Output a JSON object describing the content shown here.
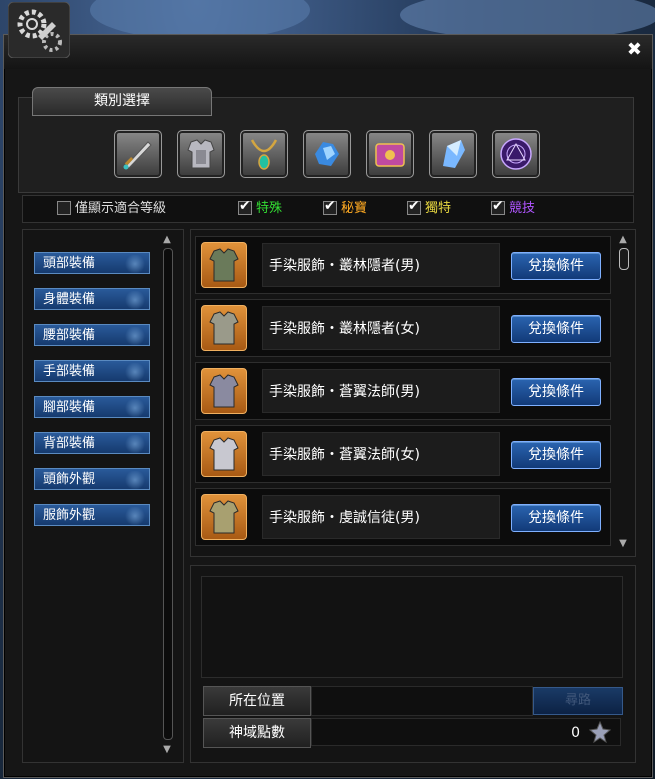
{
  "window": {
    "close_glyph": "✖"
  },
  "category": {
    "tab_label": "類別選擇",
    "icons": [
      "sword-icon",
      "armor-icon",
      "necklace-icon",
      "crystal-cluster-icon",
      "book-icon",
      "gem-icon",
      "magic-circle-icon"
    ]
  },
  "filters": {
    "only_level": {
      "label": "僅顯示適合等級",
      "checked": false
    },
    "options": [
      {
        "label": "特殊",
        "checked": true,
        "color": "#33dd33"
      },
      {
        "label": "秘寶",
        "checked": true,
        "color": "#ffaa22"
      },
      {
        "label": "獨特",
        "checked": true,
        "color": "#e8d840"
      },
      {
        "label": "競技",
        "checked": true,
        "color": "#b055ff"
      }
    ]
  },
  "sidebar": {
    "items": [
      {
        "label": "頭部裝備"
      },
      {
        "label": "身體裝備"
      },
      {
        "label": "腰部裝備"
      },
      {
        "label": "手部裝備"
      },
      {
        "label": "腳部裝備"
      },
      {
        "label": "背部裝備"
      },
      {
        "label": "頭飾外觀"
      },
      {
        "label": "服飾外觀"
      }
    ]
  },
  "items": [
    {
      "name": "手染服飾・叢林隱者(男)",
      "button": "兌換條件"
    },
    {
      "name": "手染服飾・叢林隱者(女)",
      "button": "兌換條件"
    },
    {
      "name": "手染服飾・蒼翼法師(男)",
      "button": "兌換條件"
    },
    {
      "name": "手染服飾・蒼翼法師(女)",
      "button": "兌換條件"
    },
    {
      "name": "手染服飾・虔誠信徒(男)",
      "button": "兌換條件"
    }
  ],
  "info": {
    "location_label": "所在位置",
    "location_value": "",
    "seek_button": "尋路",
    "points_label": "神域點數",
    "points_value": "0"
  },
  "colors": {
    "accent_blue": "#2a64b0",
    "item_bg_orange": "#e0923a"
  }
}
